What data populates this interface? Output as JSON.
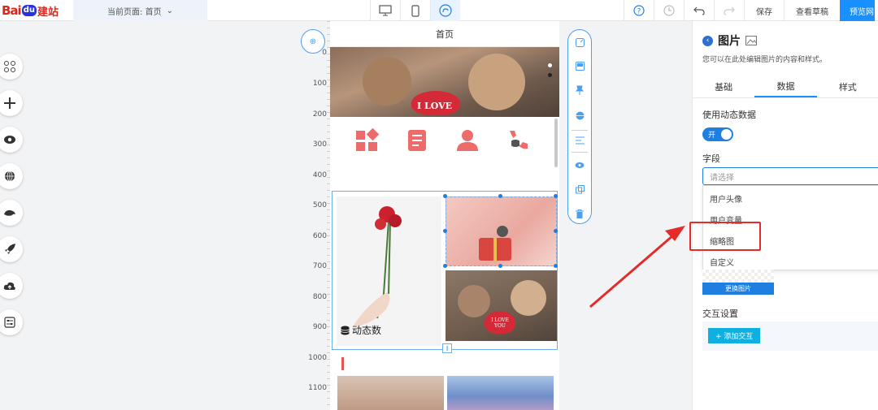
{
  "logo": {
    "part1": "Bai",
    "part2": "du",
    "part3": "建站"
  },
  "header": {
    "current_page": "当前页面: 首页",
    "save": "保存",
    "view_draft": "查看草稿",
    "preview": "预览网"
  },
  "ruler": {
    "ticks": [
      "0",
      "100",
      "200",
      "300",
      "400",
      "500",
      "600",
      "700",
      "800",
      "900",
      "1000",
      "1100"
    ]
  },
  "canvas": {
    "page_title": "首页",
    "banner_text": "I LOVE",
    "bears_text": "I LOVE YOU",
    "dynamic_label": "动态数"
  },
  "panel": {
    "title": "图片",
    "description": "您可以在此处编辑图片的内容和样式。",
    "tabs": [
      "基础",
      "数据",
      "样式"
    ],
    "use_dynamic_label": "使用动态数据",
    "toggle_text": "开",
    "field_label": "字段",
    "select_placeholder": "请选择",
    "options": [
      "用户头像",
      "用户变量",
      "缩略图",
      "自定义"
    ],
    "change_image": "更换图片",
    "interaction_label": "交互设置",
    "add_interaction": "+ 添加交互"
  },
  "colors": {
    "accent": "#1890ff",
    "icon_red": "#ee6b6b",
    "annotation": "#e62a2a"
  }
}
